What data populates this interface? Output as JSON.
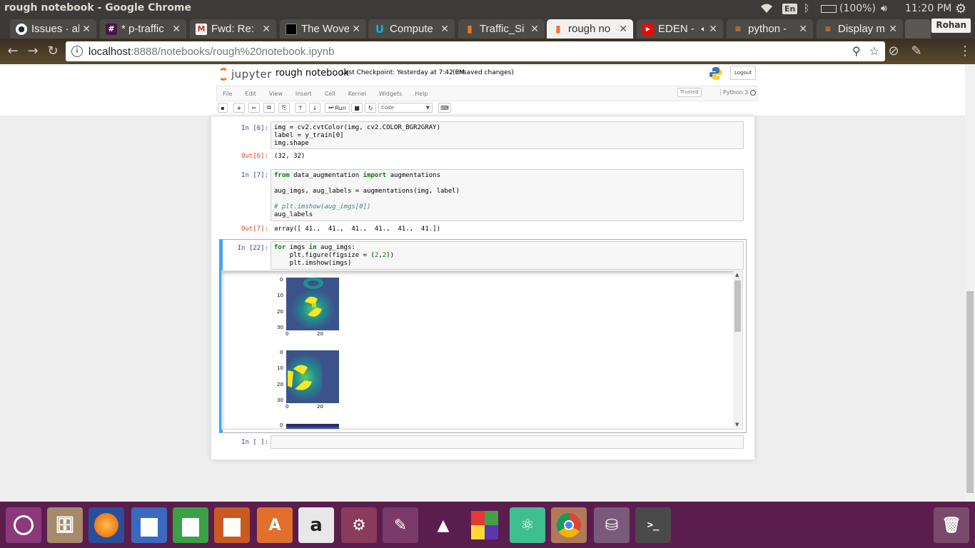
{
  "system": {
    "window_title": "rough notebook - Google Chrome",
    "keyboard": "En",
    "battery": "(100%)",
    "time": "11:20 PM"
  },
  "tabs": [
    {
      "label": "Issues · al",
      "icon": "github-icon",
      "color": "#24292e"
    },
    {
      "label": "* p-traffic",
      "icon": "slack-icon",
      "color": "#4a154b"
    },
    {
      "label": "Fwd: Re:",
      "icon": "gmail-icon",
      "color": "#d93025"
    },
    {
      "label": "The Wove",
      "icon": "site-icon",
      "color": "#000000"
    },
    {
      "label": "Compute",
      "icon": "udacity-icon",
      "color": "#02b3e4"
    },
    {
      "label": "Traffic_Si",
      "icon": "jupyter-icon",
      "color": "#f37626"
    },
    {
      "label": "rough no",
      "icon": "jupyter-icon",
      "color": "#f37626",
      "active": true
    },
    {
      "label": "EDEN -",
      "icon": "youtube-icon",
      "color": "#ff0000"
    },
    {
      "label": "python -",
      "icon": "stackoverflow-icon",
      "color": "#f48024"
    },
    {
      "label": "Display m",
      "icon": "stackoverflow-icon",
      "color": "#f48024"
    }
  ],
  "profile_name": "Rohan",
  "address": {
    "host": "localhost",
    "path": ":8888/notebooks/rough%20notebook.ipynb"
  },
  "notebook": {
    "logo_text": "jupyter",
    "name": "rough notebook",
    "checkpoint": "Last Checkpoint: Yesterday at 7:42 PM",
    "unsaved": "(unsaved changes)",
    "logout": "Logout",
    "menu": [
      "File",
      "Edit",
      "View",
      "Insert",
      "Cell",
      "Kernel",
      "Widgets",
      "Help"
    ],
    "trusted": "Trusted",
    "kernel": "Python 3",
    "toolbar": {
      "run_label": "Run",
      "cell_type": "Code"
    }
  },
  "cells": {
    "c6": {
      "in_prompt": "In [6]:",
      "lines": [
        "img = cv2.cvtColor(img, cv2.COLOR_BGR2GRAY)",
        "label = y_train[0]",
        "img.shape"
      ],
      "out_prompt": "Out[6]:",
      "output": "(32, 32)"
    },
    "c7": {
      "in_prompt": "In [7]:",
      "out_prompt": "Out[7]:",
      "output": "array([ 41.,  41.,  41.,  41.,  41.,  41.])"
    },
    "c22": {
      "in_prompt": "In [22]:"
    },
    "empty": {
      "in_prompt": "In [ ]:"
    }
  },
  "plot_ticks": {
    "y": [
      "0",
      "10",
      "20",
      "30"
    ],
    "x": [
      "0",
      "20"
    ]
  },
  "colors": {
    "viridis_dark": "#440154",
    "viridis_mid": "#21908d",
    "viridis_bright": "#fde725",
    "selected_cell": "#42a5f5"
  },
  "launcher": [
    "ubuntu-dash-icon",
    "files-icon",
    "firefox-icon",
    "writer-icon",
    "calc-icon",
    "impress-icon",
    "software-center-icon",
    "amazon-icon",
    "settings-icon",
    "gimp-icon",
    "inkscape-icon",
    "blocks-icon",
    "atom-icon",
    "chrome-icon",
    "disk-icon",
    "terminal-icon",
    "trash-icon"
  ]
}
